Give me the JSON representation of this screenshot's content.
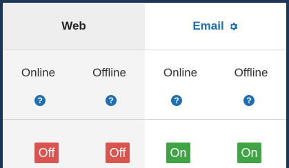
{
  "header": {
    "web_label": "Web",
    "email_label": "Email",
    "settings_icon": "gear-icon",
    "email_color": "#1f6fb2"
  },
  "columns": [
    {
      "group": "Web",
      "label": "Online",
      "help_glyph": "?",
      "status": "Off"
    },
    {
      "group": "Web",
      "label": "Offline",
      "help_glyph": "?",
      "status": "Off"
    },
    {
      "group": "Email",
      "label": "Online",
      "help_glyph": "?",
      "status": "On"
    },
    {
      "group": "Email",
      "label": "Offline",
      "help_glyph": "?",
      "status": "On"
    }
  ],
  "colors": {
    "off": "#d9534f",
    "on": "#3fa544",
    "help": "#1f6fb2",
    "frame": "#1d3557"
  }
}
